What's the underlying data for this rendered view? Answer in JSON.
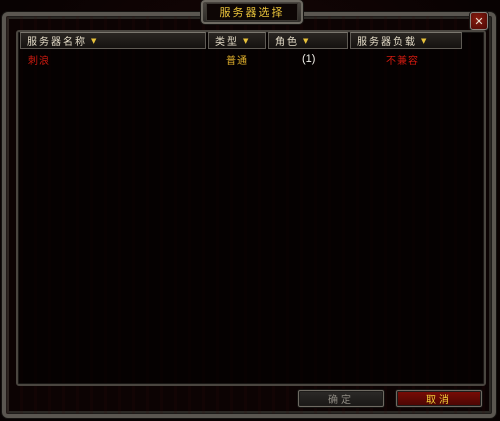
{
  "window": {
    "title": "服务器选择",
    "close_label": "✕"
  },
  "columns": [
    {
      "label": "服务器名称",
      "sort_icon": "sort-arrow-icon"
    },
    {
      "label": "类型",
      "sort_icon": "sort-arrow-icon"
    },
    {
      "label": "角色",
      "sort_icon": "sort-arrow-icon"
    },
    {
      "label": "服务器负载",
      "sort_icon": "sort-arrow-icon"
    }
  ],
  "sort_glyph": "▼",
  "rows": [
    {
      "name": "刺浪",
      "type": "普通",
      "role": "(1)",
      "load": "不兼容"
    }
  ],
  "buttons": {
    "ok_label": "确定",
    "cancel_label": "取消"
  },
  "colors": {
    "title_text": "#e8c23a",
    "incompatible_text": "#d01a10",
    "type_text": "#e0b02c",
    "cancel_bg": "#7a0c06"
  }
}
